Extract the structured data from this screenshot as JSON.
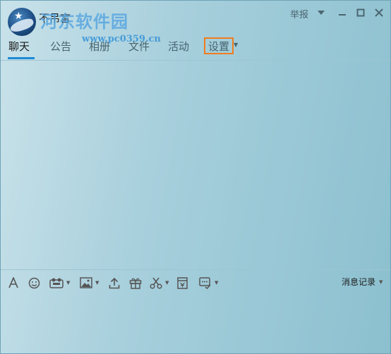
{
  "header": {
    "group_name": "不吊言",
    "report_label": "举报",
    "watermark_title": "河东软件园",
    "watermark_url": "www.pc0359.cn"
  },
  "tabs": [
    {
      "label": "聊天",
      "active": true
    },
    {
      "label": "公告",
      "active": false
    },
    {
      "label": "相册",
      "active": false
    },
    {
      "label": "文件",
      "active": false
    },
    {
      "label": "活动",
      "active": false
    },
    {
      "label": "设置",
      "active": false,
      "highlighted": true
    }
  ],
  "toolbar": {
    "tools": [
      {
        "icon": "font-icon"
      },
      {
        "icon": "emoji-icon"
      },
      {
        "icon": "gif-icon"
      },
      {
        "icon": "image-icon"
      },
      {
        "icon": "upload-icon"
      },
      {
        "icon": "gift-icon"
      },
      {
        "icon": "scissors-icon"
      },
      {
        "icon": "red-packet-icon"
      },
      {
        "icon": "more-icon"
      }
    ],
    "history_label": "消息记录"
  },
  "colors": {
    "accent": "#1e8ad6",
    "highlight_border": "#f07d1e",
    "background": "#a7cfdc"
  }
}
